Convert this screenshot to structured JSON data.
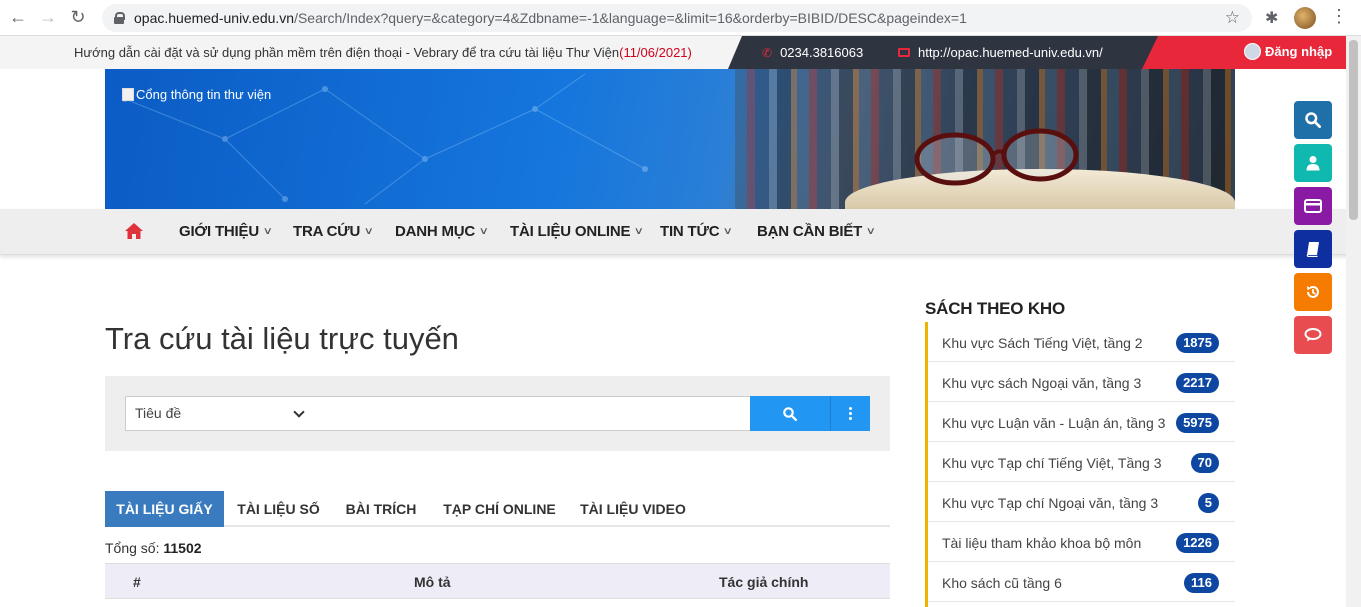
{
  "browser": {
    "url_host": "opac.huemed-univ.edu.vn",
    "url_path": "/Search/Index?query=&category=4&Zdbname=-1&language=&limit=16&orderby=BIBID/DESC&pageindex=1"
  },
  "topbar": {
    "announcement": "Hướng dẫn cài đặt và sử dụng phần mềm trên điện thoại - Vebrary để tra cứu tài liệu Thư Viện",
    "announcement_date": "(11/06/2021)",
    "phone": "0234.3816063",
    "website": "http://opac.huemed-univ.edu.vn/",
    "login": "Đăng nhập"
  },
  "banner": {
    "logo_alt": "Cổng thông tin thư viện"
  },
  "menu": {
    "items": [
      {
        "label": "GIỚI THIỆU"
      },
      {
        "label": "TRA CỨU"
      },
      {
        "label": "DANH MỤC"
      },
      {
        "label": "TÀI LIỆU ONLINE"
      },
      {
        "label": "TIN TỨC"
      },
      {
        "label": "BẠN CẦN BIẾT"
      }
    ]
  },
  "main": {
    "title": "Tra cứu tài liệu trực tuyến",
    "search_field": "Tiêu đề",
    "search_value": "",
    "tabs": [
      {
        "label": "TÀI LIỆU GIẤY",
        "active": true
      },
      {
        "label": "TÀI LIỆU SỐ"
      },
      {
        "label": "BÀI TRÍCH"
      },
      {
        "label": "TẠP CHÍ ONLINE"
      },
      {
        "label": "TÀI LIỆU VIDEO"
      }
    ],
    "total_label": "Tổng số:",
    "total_value": "11502",
    "table_headers": [
      "#",
      "Mô tả",
      "Tác giả chính"
    ]
  },
  "sidebar": {
    "title": "SÁCH THEO KHO",
    "items": [
      {
        "label": "Khu vực Sách Tiếng Việt, tầng 2",
        "count": "1875"
      },
      {
        "label": "Khu vực sách Ngoại văn, tầng 3",
        "count": "2217"
      },
      {
        "label": "Khu vực Luận văn - Luận án, tầng 3",
        "count": "5975"
      },
      {
        "label": "Khu vực Tạp chí Tiếng Việt, Tầng 3",
        "count": "70"
      },
      {
        "label": "Khu vực Tạp chí Ngoại văn, tầng 3",
        "count": "5"
      },
      {
        "label": "Tài liệu tham khảo khoa bộ môn",
        "count": "1226"
      },
      {
        "label": "Kho sách cũ tầng 6",
        "count": "116"
      }
    ]
  },
  "colors": {
    "accent_blue": "#2196f3",
    "tab_active": "#3a7bbf",
    "badge": "#0d47a1",
    "red": "#e8273a",
    "sidebar_border": "#f0b400",
    "fab_search": "#1f6fa8",
    "fab_user": "#10b9b0",
    "fab_card": "#8a1aa3",
    "fab_book": "#0d2fa0",
    "fab_history": "#f57c00",
    "fab_chat": "#e84c50"
  }
}
